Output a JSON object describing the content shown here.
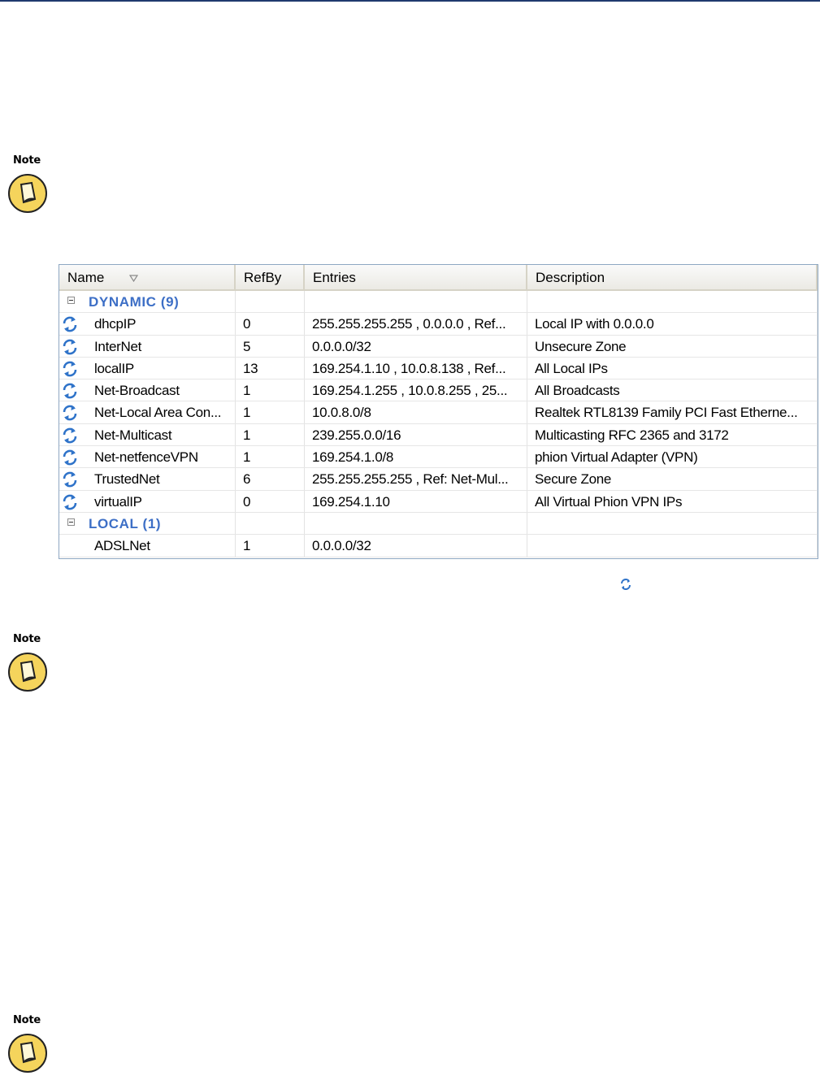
{
  "notes": [
    {
      "label": "Note"
    },
    {
      "label": "Note"
    },
    {
      "label": "Note"
    }
  ],
  "table": {
    "headers": {
      "name": "Name",
      "refby": "RefBy",
      "entries": "Entries",
      "description": "Description"
    },
    "groups": [
      {
        "title": "DYNAMIC (9)",
        "rows": [
          {
            "name": "dhcpIP",
            "refby": "0",
            "entries": "255.255.255.255 , 0.0.0.0 , Ref...",
            "description": "Local IP with 0.0.0.0"
          },
          {
            "name": "InterNet",
            "refby": "5",
            "entries": "0.0.0.0/32",
            "description": "Unsecure Zone"
          },
          {
            "name": "localIP",
            "refby": "13",
            "entries": "169.254.1.10 , 10.0.8.138 , Ref...",
            "description": "All Local IPs"
          },
          {
            "name": "Net-Broadcast",
            "refby": "1",
            "entries": "169.254.1.255 , 10.0.8.255 , 25...",
            "description": "All Broadcasts"
          },
          {
            "name": "Net-Local Area Con...",
            "refby": "1",
            "entries": "10.0.8.0/8",
            "description": "Realtek RTL8139 Family PCI Fast Etherne..."
          },
          {
            "name": "Net-Multicast",
            "refby": "1",
            "entries": "239.255.0.0/16",
            "description": "Multicasting RFC 2365 and 3172"
          },
          {
            "name": "Net-netfenceVPN",
            "refby": "1",
            "entries": "169.254.1.0/8",
            "description": "phion Virtual Adapter (VPN)"
          },
          {
            "name": "TrustedNet",
            "refby": "6",
            "entries": "255.255.255.255 , Ref: Net-Mul...",
            "description": "Secure Zone"
          },
          {
            "name": "virtualIP",
            "refby": "0",
            "entries": "169.254.1.10",
            "description": "All Virtual Phion VPN IPs"
          }
        ]
      },
      {
        "title": "LOCAL (1)",
        "rows": [
          {
            "name": "ADSLNet",
            "refby": "1",
            "entries": "0.0.0.0/32",
            "description": ""
          }
        ]
      }
    ]
  },
  "icons": {
    "note": "note-pad-icon",
    "dynamic": "refresh-arrows-icon",
    "sort": "sort-descending-icon",
    "collapse": "collapse-minus-icon"
  },
  "colors": {
    "accent": "#3d6fc6",
    "rule": "#1f3a6e",
    "note_badge": "#f5d45c"
  }
}
